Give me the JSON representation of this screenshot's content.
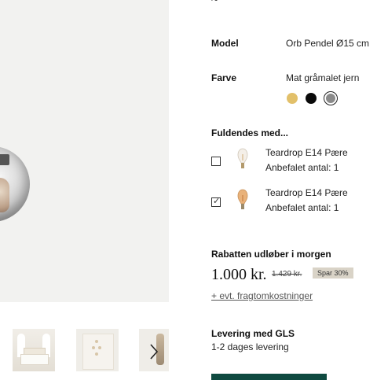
{
  "product": {
    "title_fragment": "~ ’ ’"
  },
  "specs": {
    "model_label": "Model",
    "model_value": "Orb Pendel Ø15 cm",
    "color_label": "Farve",
    "color_value": "Mat gråmalet jern",
    "swatches": [
      {
        "name": "brass",
        "color": "#e2c06a"
      },
      {
        "name": "black",
        "color": "#0a0a0a"
      },
      {
        "name": "grey",
        "color": "#8a8a8a",
        "selected": true
      }
    ]
  },
  "addons": {
    "heading": "Fuldendes med...",
    "items": [
      {
        "name": "Teardrop E14 Pære",
        "qty": "Anbefalet antal: 1",
        "checked": false
      },
      {
        "name": "Teardrop E14 Pære",
        "qty": "Anbefalet antal: 1",
        "checked": true
      }
    ]
  },
  "pricing": {
    "discount_notice": "Rabatten udløber i morgen",
    "current_price": "1.000 kr.",
    "old_price": "1.429 kr.",
    "badge": "Spar 30%",
    "shipping_link": "+ evt. fragtomkostninger"
  },
  "delivery": {
    "title": "Levering med GLS",
    "subtitle": "1-2 dages levering"
  },
  "colors": {
    "cta": "#0f4a40",
    "gallery_bg": "#f2f2f0"
  }
}
